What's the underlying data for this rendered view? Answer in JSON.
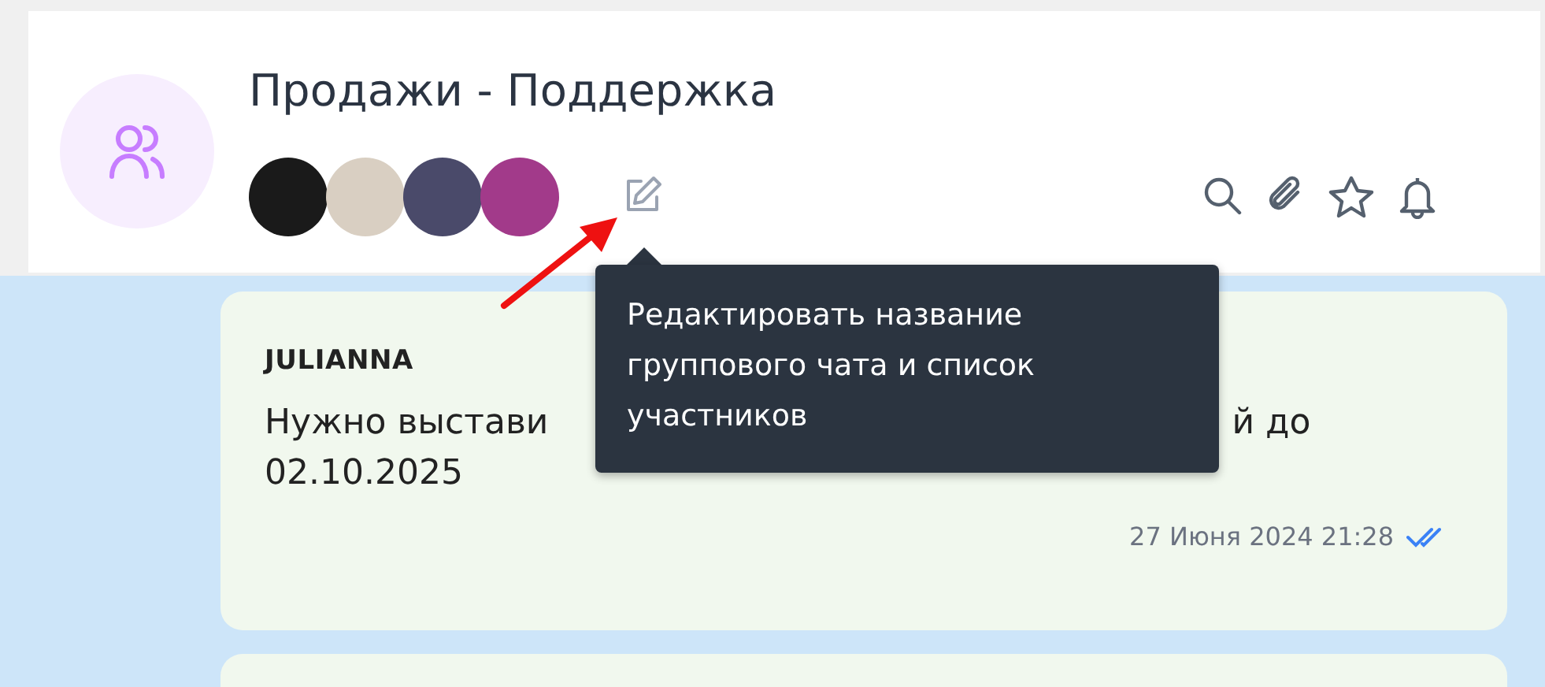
{
  "chat": {
    "title": "Продажи - Поддержка",
    "members": [
      {
        "kind": "photo"
      },
      {
        "kind": "photo"
      },
      {
        "kind": "photo"
      },
      {
        "kind": "photo"
      }
    ]
  },
  "tooltip": {
    "text": "Редактировать название группового чата и список участников"
  },
  "messages": [
    {
      "sender": "JULIANNA",
      "text_start": "Нужно выстави",
      "text_end": "й до",
      "text_line2": "02.10.2025",
      "time": "27 Июня 2024 21:28",
      "read": true
    }
  ]
}
